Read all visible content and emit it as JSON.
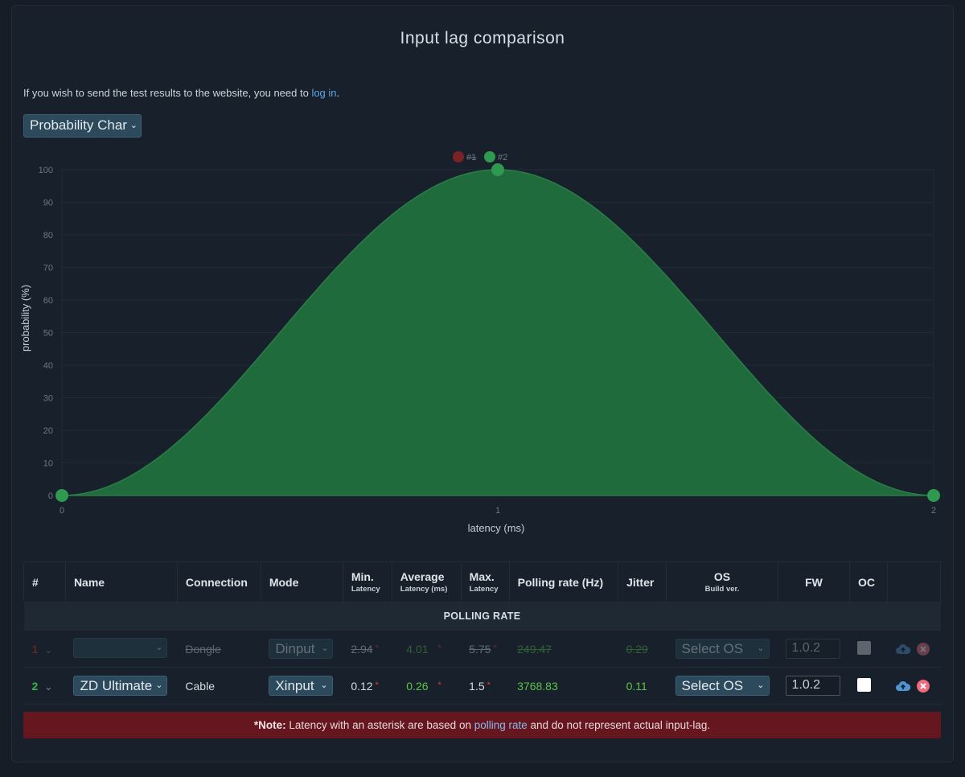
{
  "page": {
    "title": "Input lag comparison",
    "login_text_before": "If you wish to send the test results to the website, you need to ",
    "login_link": "log in",
    "login_text_after": ".",
    "chart_select_value": "Probability Char"
  },
  "chart_data": {
    "type": "area",
    "xlabel": "latency (ms)",
    "ylabel": "probability (%)",
    "xlim": [
      0,
      2
    ],
    "ylim": [
      0,
      100
    ],
    "x_ticks": [
      "0",
      "1",
      "2"
    ],
    "y_ticks": [
      "0",
      "10",
      "20",
      "30",
      "40",
      "50",
      "60",
      "70",
      "80",
      "90",
      "100"
    ],
    "legend": [
      {
        "label": "#1",
        "color": "#7a2228",
        "hidden": true
      },
      {
        "label": "#2",
        "color": "#2f9a4f",
        "hidden": false
      }
    ],
    "series": [
      {
        "name": "#2",
        "color": "#1f6b3c",
        "x": [
          0,
          1,
          2
        ],
        "y": [
          0,
          100,
          0
        ]
      }
    ]
  },
  "table": {
    "headers": {
      "index": "#",
      "name": "Name",
      "connection": "Connection",
      "mode": "Mode",
      "min": "Min.",
      "min_sub": "Latency",
      "avg": "Average",
      "avg_sub": "Latency (ms)",
      "max": "Max.",
      "max_sub": "Latency",
      "polling": "Polling rate (Hz)",
      "jitter": "Jitter",
      "os": "OS",
      "os_sub": "Build ver.",
      "fw": "FW",
      "oc": "OC"
    },
    "group_label": "POLLING RATE",
    "rows": [
      {
        "index": "1",
        "name": "",
        "connection": "Dongle",
        "mode": "Dinput",
        "min": "2.94",
        "avg": "4.01",
        "max": "5.75",
        "polling": "249.47",
        "jitter": "0.29",
        "os": "Select OS",
        "fw": "1.0.2",
        "disabled": true
      },
      {
        "index": "2",
        "name": "ZD Ultimate",
        "connection": "Cable",
        "mode": "Xinput",
        "min": "0.12",
        "avg": "0.26",
        "max": "1.5",
        "polling": "3768.83",
        "jitter": "0.11",
        "os": "Select OS",
        "fw": "1.0.2",
        "disabled": false
      }
    ],
    "asterisk": "*"
  },
  "note": {
    "bold": "*Note:",
    "text_before": " Latency with an asterisk are based on ",
    "link": "polling rate",
    "text_after": " and do not represent actual input-lag."
  },
  "icons": {
    "chevron": "chevron-down-icon",
    "upload": "cloud-upload-icon",
    "remove": "close-circle-icon"
  }
}
